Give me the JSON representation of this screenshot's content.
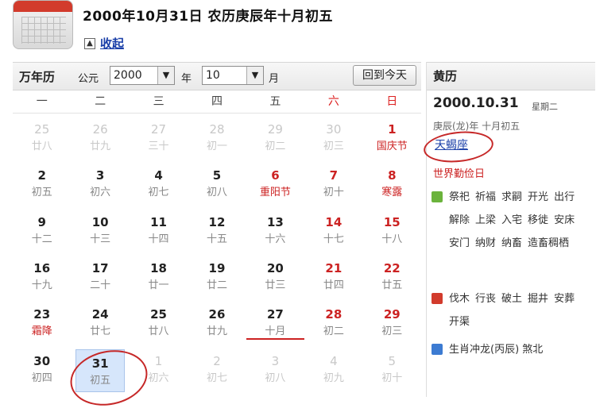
{
  "header": {
    "date_text": "2000年10月31日  农历庚辰年十月初五",
    "collapse_label": "收起"
  },
  "toolbar": {
    "title": "万年历",
    "year_label": "公元",
    "year_value": "2000",
    "month_value": "10",
    "year_suffix": "年",
    "month_suffix": "月",
    "today_button": "回到今天"
  },
  "weekdays": [
    "一",
    "二",
    "三",
    "四",
    "五",
    "六",
    "日"
  ],
  "days": [
    {
      "num": "25",
      "lunar": "廿八",
      "type": "other"
    },
    {
      "num": "26",
      "lunar": "廿九",
      "type": "other"
    },
    {
      "num": "27",
      "lunar": "三十",
      "type": "other"
    },
    {
      "num": "28",
      "lunar": "初一",
      "type": "other"
    },
    {
      "num": "29",
      "lunar": "初二",
      "type": "other"
    },
    {
      "num": "30",
      "lunar": "初三",
      "type": "other"
    },
    {
      "num": "1",
      "lunar": "国庆节",
      "type": "holiday"
    },
    {
      "num": "2",
      "lunar": "初五",
      "type": ""
    },
    {
      "num": "3",
      "lunar": "初六",
      "type": ""
    },
    {
      "num": "4",
      "lunar": "初七",
      "type": ""
    },
    {
      "num": "5",
      "lunar": "初八",
      "type": ""
    },
    {
      "num": "6",
      "lunar": "重阳节",
      "type": "holiday"
    },
    {
      "num": "7",
      "lunar": "初十",
      "type": "weekend"
    },
    {
      "num": "8",
      "lunar": "寒露",
      "type": "weekend-term"
    },
    {
      "num": "9",
      "lunar": "十二",
      "type": ""
    },
    {
      "num": "10",
      "lunar": "十三",
      "type": ""
    },
    {
      "num": "11",
      "lunar": "十四",
      "type": ""
    },
    {
      "num": "12",
      "lunar": "十五",
      "type": ""
    },
    {
      "num": "13",
      "lunar": "十六",
      "type": ""
    },
    {
      "num": "14",
      "lunar": "十七",
      "type": "weekend"
    },
    {
      "num": "15",
      "lunar": "十八",
      "type": "weekend"
    },
    {
      "num": "16",
      "lunar": "十九",
      "type": ""
    },
    {
      "num": "17",
      "lunar": "二十",
      "type": ""
    },
    {
      "num": "18",
      "lunar": "廿一",
      "type": ""
    },
    {
      "num": "19",
      "lunar": "廿二",
      "type": ""
    },
    {
      "num": "20",
      "lunar": "廿三",
      "type": ""
    },
    {
      "num": "21",
      "lunar": "廿四",
      "type": "weekend"
    },
    {
      "num": "22",
      "lunar": "廿五",
      "type": "weekend"
    },
    {
      "num": "23",
      "lunar": "霜降",
      "type": "term"
    },
    {
      "num": "24",
      "lunar": "廿七",
      "type": ""
    },
    {
      "num": "25",
      "lunar": "廿八",
      "type": ""
    },
    {
      "num": "26",
      "lunar": "廿九",
      "type": ""
    },
    {
      "num": "27",
      "lunar": "十月",
      "type": "underline"
    },
    {
      "num": "28",
      "lunar": "初二",
      "type": "weekend"
    },
    {
      "num": "29",
      "lunar": "初三",
      "type": "weekend"
    },
    {
      "num": "30",
      "lunar": "初四",
      "type": ""
    },
    {
      "num": "31",
      "lunar": "初五",
      "type": "selected"
    },
    {
      "num": "1",
      "lunar": "初六",
      "type": "other"
    },
    {
      "num": "2",
      "lunar": "初七",
      "type": "other"
    },
    {
      "num": "3",
      "lunar": "初八",
      "type": "other"
    },
    {
      "num": "4",
      "lunar": "初九",
      "type": "other"
    },
    {
      "num": "5",
      "lunar": "初十",
      "type": "other"
    }
  ],
  "almanac": {
    "title": "黄历",
    "date": "2000.10.31",
    "weekday": "星期二",
    "lunar": "庚辰(龙)年 十月初五",
    "zodiac_sign": "天蝎座",
    "festival": "世界勤俭日",
    "suitable": [
      "祭祀",
      "祈福",
      "求嗣",
      "开光",
      "出行",
      "解除",
      "上梁",
      "入宅",
      "移徙",
      "安床",
      "安门",
      "纳财",
      "纳畜",
      "造畜稠栖"
    ],
    "avoid": [
      "伐木",
      "行丧",
      "破土",
      "掘井",
      "安葬",
      "开渠"
    ],
    "clash": "生肖冲龙(丙辰) 煞北",
    "colors": {
      "suitable": "#6bb33c",
      "avoid": "#d23b2c",
      "clash": "#3c7bd2"
    }
  }
}
